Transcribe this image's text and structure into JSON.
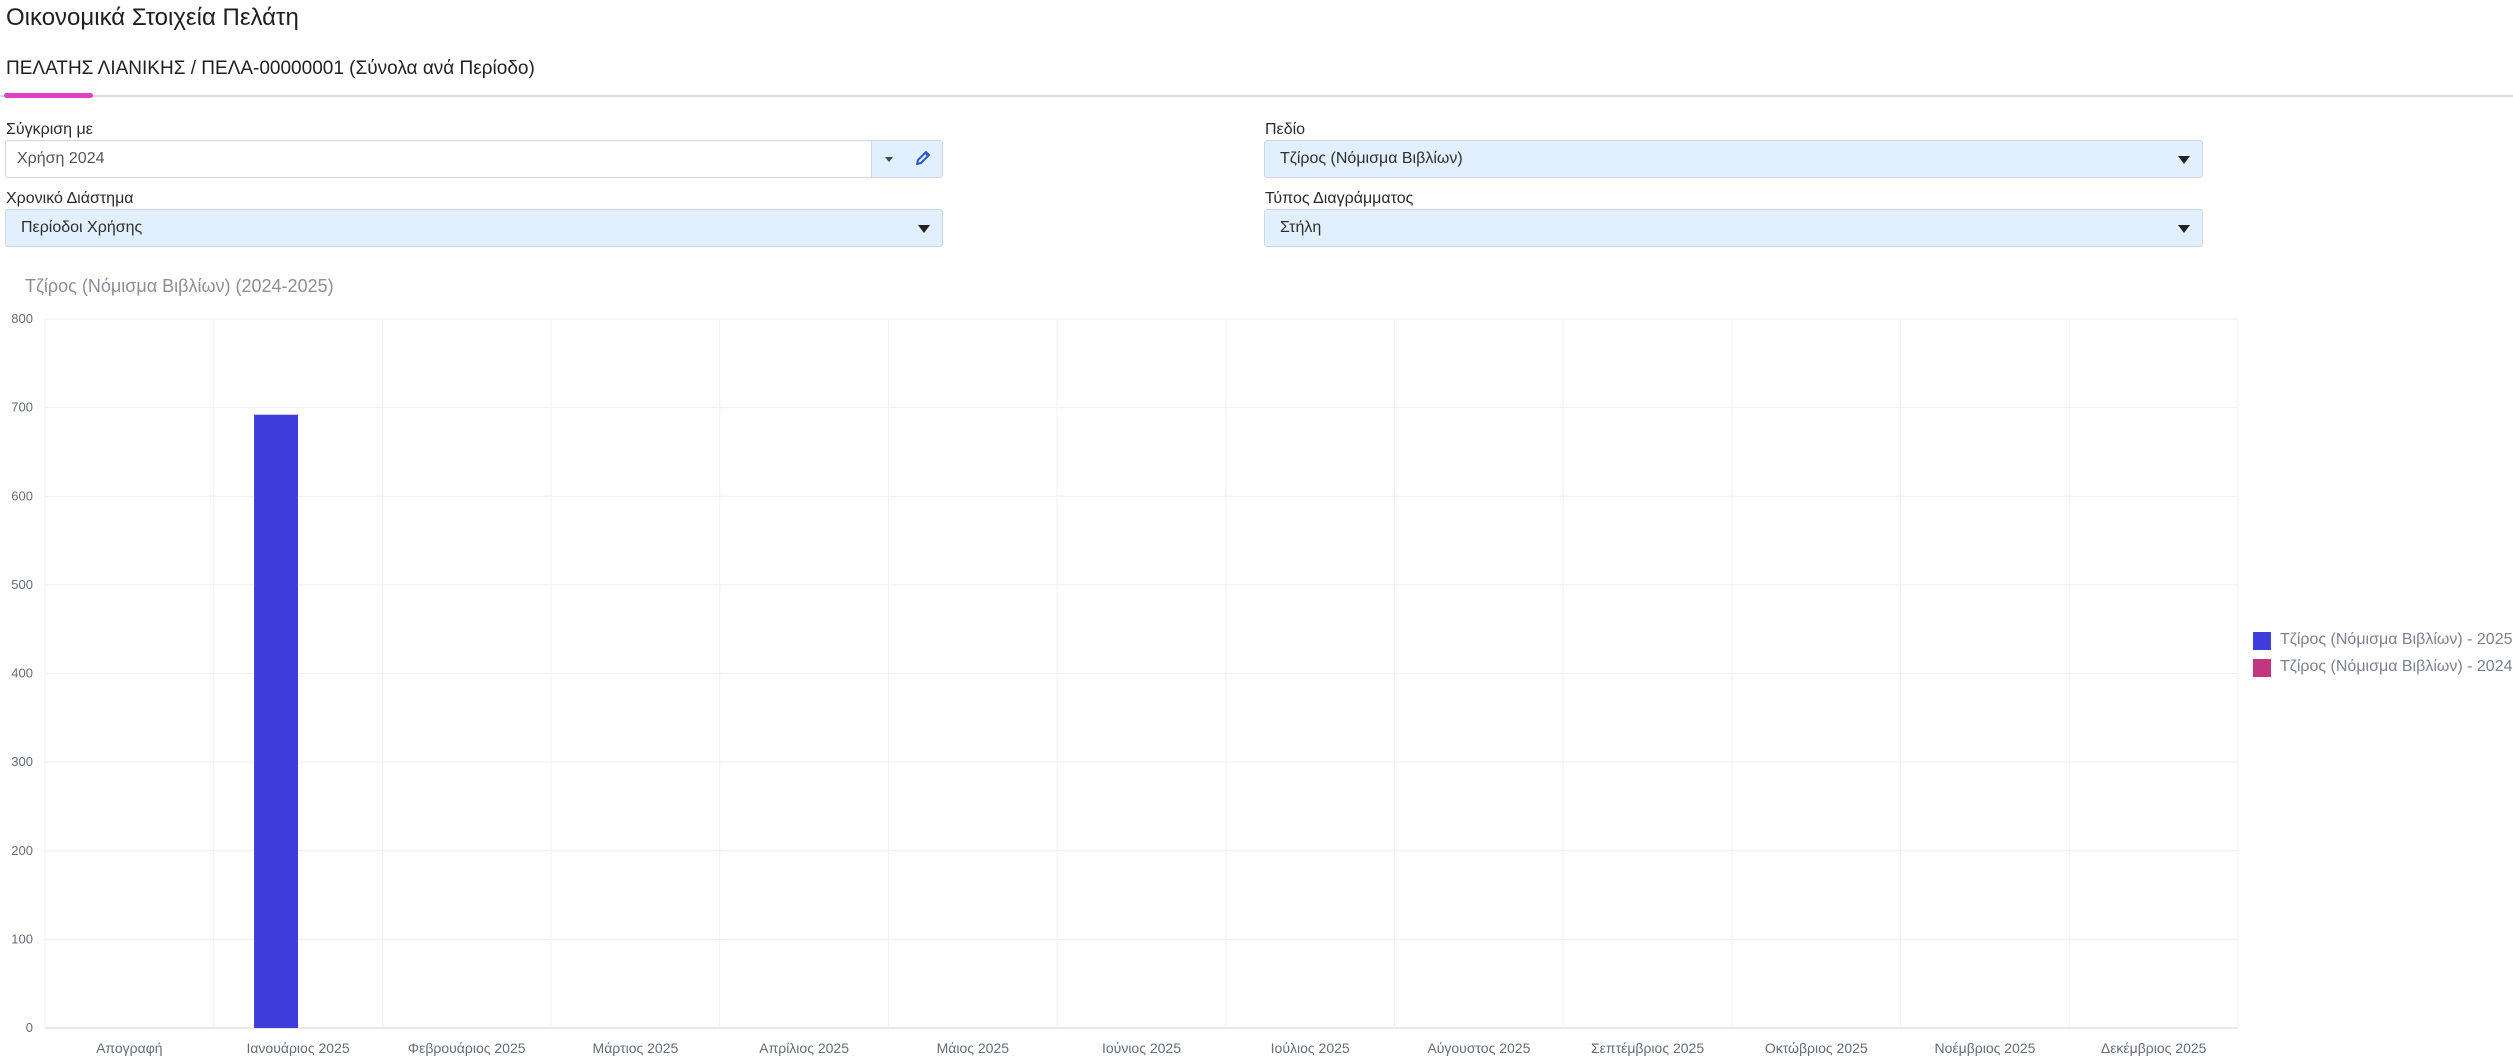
{
  "page": {
    "title": "Οικονομικά Στοιχεία Πελάτη",
    "tab_label": "ΠΕΛΑΤΗΣ ΛΙΑΝΙΚΗΣ / ΠΕΛΑ-00000001 (Σύνολα ανά Περίοδο)"
  },
  "filters": {
    "compare": {
      "label": "Σύγκριση με",
      "value": "Χρήση 2024"
    },
    "field": {
      "label": "Πεδίο",
      "value": "Τζίρος (Νόμισμα Βιβλίων)"
    },
    "period": {
      "label": "Χρονικό Διάστημα",
      "value": "Περίοδοι Χρήσης"
    },
    "chart_type": {
      "label": "Τύπος Διαγράμματος",
      "value": "Στήλη"
    }
  },
  "icons": {
    "dropdown": "chevron-down-icon",
    "edit": "pencil-icon"
  },
  "chart_data": {
    "type": "bar",
    "title": "Τζίρος (Νόμισμα Βιβλίων) (2024-2025)",
    "xlabel": "",
    "ylabel": "",
    "categories": [
      "Απογραφή",
      "Ιανουάριος 2025",
      "Φεβρουάριος 2025",
      "Μάρτιος 2025",
      "Απρίλιος 2025",
      "Μάιος 2025",
      "Ιούνιος 2025",
      "Ιούλιος 2025",
      "Αύγουστος 2025",
      "Σεπτέμβριος 2025",
      "Οκτώβριος 2025",
      "Νοέμβριος 2025",
      "Δεκέμβριος 2025"
    ],
    "series": [
      {
        "name": "Τζίρος (Νόμισμα Βιβλίων) - 2025",
        "color": "#3f3ddb",
        "values": [
          0,
          692,
          0,
          0,
          0,
          0,
          0,
          0,
          0,
          0,
          0,
          0,
          0
        ]
      },
      {
        "name": "Τζίρος (Νόμισμα Βιβλίων) - 2024",
        "color": "#c2357f",
        "values": [
          0,
          0,
          0,
          0,
          0,
          0,
          0,
          0,
          0,
          0,
          0,
          0,
          0
        ]
      }
    ],
    "ylim": [
      0,
      800
    ],
    "yticks": [
      0,
      100,
      200,
      300,
      400,
      500,
      600,
      700,
      800
    ],
    "grid": true,
    "legend_position": "right"
  }
}
